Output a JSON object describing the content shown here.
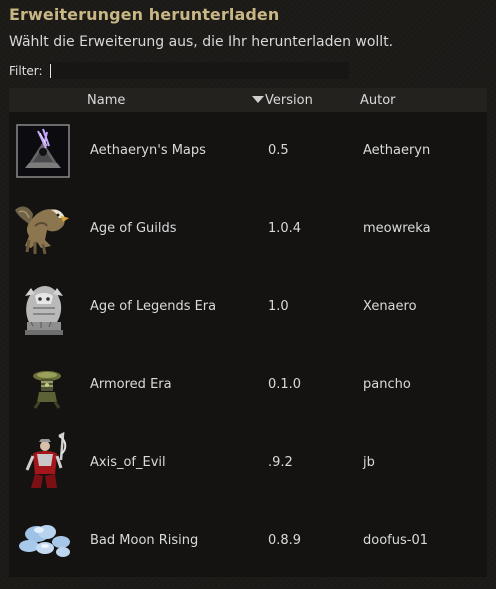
{
  "dialog": {
    "title": "Erweiterungen herunterladen",
    "subtitle": "Wählt die Erweiterung aus, die Ihr herunterladen wollt."
  },
  "filter": {
    "label": "Filter:",
    "value": ""
  },
  "table": {
    "columns": {
      "name": "Name",
      "version": "Version",
      "author": "Autor"
    },
    "sort_column": "version",
    "sort_direction": "descending",
    "rows": [
      {
        "name": "Aethaeryn's Maps",
        "version": "0.5",
        "author": "Aethaeryn",
        "icon": "portal-icon"
      },
      {
        "name": "Age of Guilds",
        "version": "1.0.4",
        "author": "meowreka",
        "icon": "gryphon-icon"
      },
      {
        "name": "Age of Legends Era",
        "version": "1.0",
        "author": "Xenaero",
        "icon": "statue-icon"
      },
      {
        "name": "Armored Era",
        "version": "0.1.0",
        "author": "pancho",
        "icon": "armor-unit-icon"
      },
      {
        "name": "Axis_of_Evil",
        "version": ".9.2",
        "author": "jb",
        "icon": "warrior-icon"
      },
      {
        "name": "Bad Moon Rising",
        "version": "0.8.9",
        "author": "doofus-01",
        "icon": "cloud-icon"
      }
    ]
  },
  "colors": {
    "title": "#c8b685",
    "background": "#1c1a17",
    "table_background": "#141312",
    "header_background": "#24221f"
  }
}
